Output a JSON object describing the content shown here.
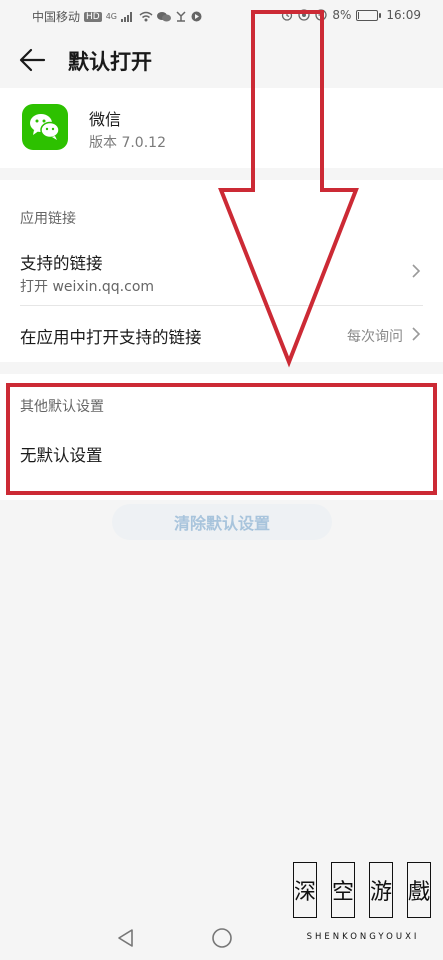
{
  "status_bar": {
    "carrier": "中国移动",
    "network_badge": "HD",
    "signal": "4G",
    "battery_percent": "8%",
    "battery_level": 0.08,
    "time": "16:09",
    "icons": [
      "signal-icon",
      "wifi-icon",
      "wechat-notification-icon",
      "app-notification-icon",
      "alarm-icon",
      "location-icon",
      "battery-icon"
    ]
  },
  "header": {
    "title": "默认打开",
    "back_icon": "arrow-left-icon"
  },
  "app": {
    "name": "微信",
    "version": "版本 7.0.12",
    "icon": "wechat-logo-icon",
    "icon_color": "#2dc100"
  },
  "app_links": {
    "section_title": "应用链接",
    "supported_links": {
      "title": "支持的链接",
      "subtitle": "打开 weixin.qq.com"
    },
    "open_in_app": {
      "title": "在应用中打开支持的链接",
      "value": "每次询问"
    }
  },
  "other_defaults": {
    "section_title": "其他默认设置",
    "value": "无默认设置"
  },
  "clear_button": {
    "label": "清除默认设置"
  },
  "annotation": {
    "color": "#cc2a35"
  },
  "watermark": {
    "chars": [
      "深",
      "空",
      "游",
      "戲"
    ],
    "text": "SHENKONGYOUXI"
  },
  "nav_bar": {
    "back_icon": "triangle-back-icon",
    "home_icon": "circle-home-icon"
  }
}
